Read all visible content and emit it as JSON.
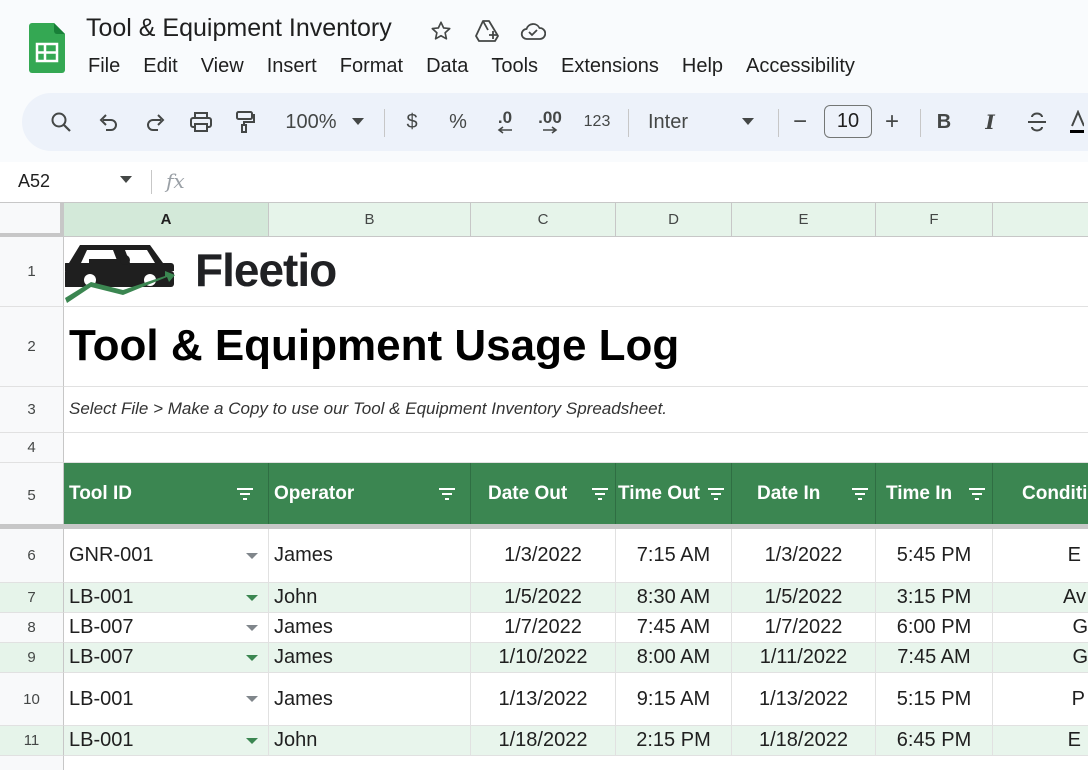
{
  "app": {
    "title": "Tool & Equipment Inventory",
    "menu": [
      "File",
      "Edit",
      "View",
      "Insert",
      "Format",
      "Data",
      "Tools",
      "Extensions",
      "Help",
      "Accessibility"
    ]
  },
  "toolbar": {
    "zoom": "100%",
    "currency": "$",
    "percent": "%",
    "decrease_decimal": ".0",
    "increase_decimal": ".00",
    "number_format": "123",
    "font": "Inter",
    "font_size": "10",
    "minus": "−",
    "plus": "+",
    "bold": "B",
    "italic": "I"
  },
  "formula_bar": {
    "cell_ref": "A52",
    "fx": "fx"
  },
  "columns": [
    "A",
    "B",
    "C",
    "D",
    "E",
    "F"
  ],
  "rows": [
    "1",
    "2",
    "3",
    "4",
    "5",
    "6",
    "7",
    "8",
    "9",
    "10",
    "11"
  ],
  "sheet": {
    "brand": "Fleetio",
    "heading": "Tool & Equipment Usage Log",
    "subtitle": "Select File > Make a Copy to use our Tool & Equipment Inventory Spreadsheet.",
    "headers": [
      "Tool ID",
      "Operator",
      "Date Out",
      "Time Out",
      "Date In",
      "Time In",
      "Conditi"
    ],
    "data": [
      {
        "tool": "GNR-001",
        "operator": "James",
        "date_out": "1/3/2022",
        "time_out": "7:15 AM",
        "date_in": "1/3/2022",
        "time_in": "5:45 PM",
        "cond": "E"
      },
      {
        "tool": "LB-001",
        "operator": "John",
        "date_out": "1/5/2022",
        "time_out": "8:30 AM",
        "date_in": "1/5/2022",
        "time_in": "3:15 PM",
        "cond": "Av"
      },
      {
        "tool": "LB-007",
        "operator": "James",
        "date_out": "1/7/2022",
        "time_out": "7:45 AM",
        "date_in": "1/7/2022",
        "time_in": "6:00 PM",
        "cond": "G"
      },
      {
        "tool": "LB-007",
        "operator": "James",
        "date_out": "1/10/2022",
        "time_out": "8:00 AM",
        "date_in": "1/11/2022",
        "time_in": "7:45 AM",
        "cond": "G"
      },
      {
        "tool": "LB-001",
        "operator": "James",
        "date_out": "1/13/2022",
        "time_out": "9:15 AM",
        "date_in": "1/13/2022",
        "time_in": "5:15 PM",
        "cond": "P"
      },
      {
        "tool": "LB-001",
        "operator": "John",
        "date_out": "1/18/2022",
        "time_out": "2:15 PM",
        "date_in": "1/18/2022",
        "time_in": "6:45 PM",
        "cond": "E"
      }
    ]
  },
  "colors": {
    "header_green": "#3b8651",
    "band_green": "#e8f5ec",
    "toolbar_bg": "#edf2fa"
  }
}
